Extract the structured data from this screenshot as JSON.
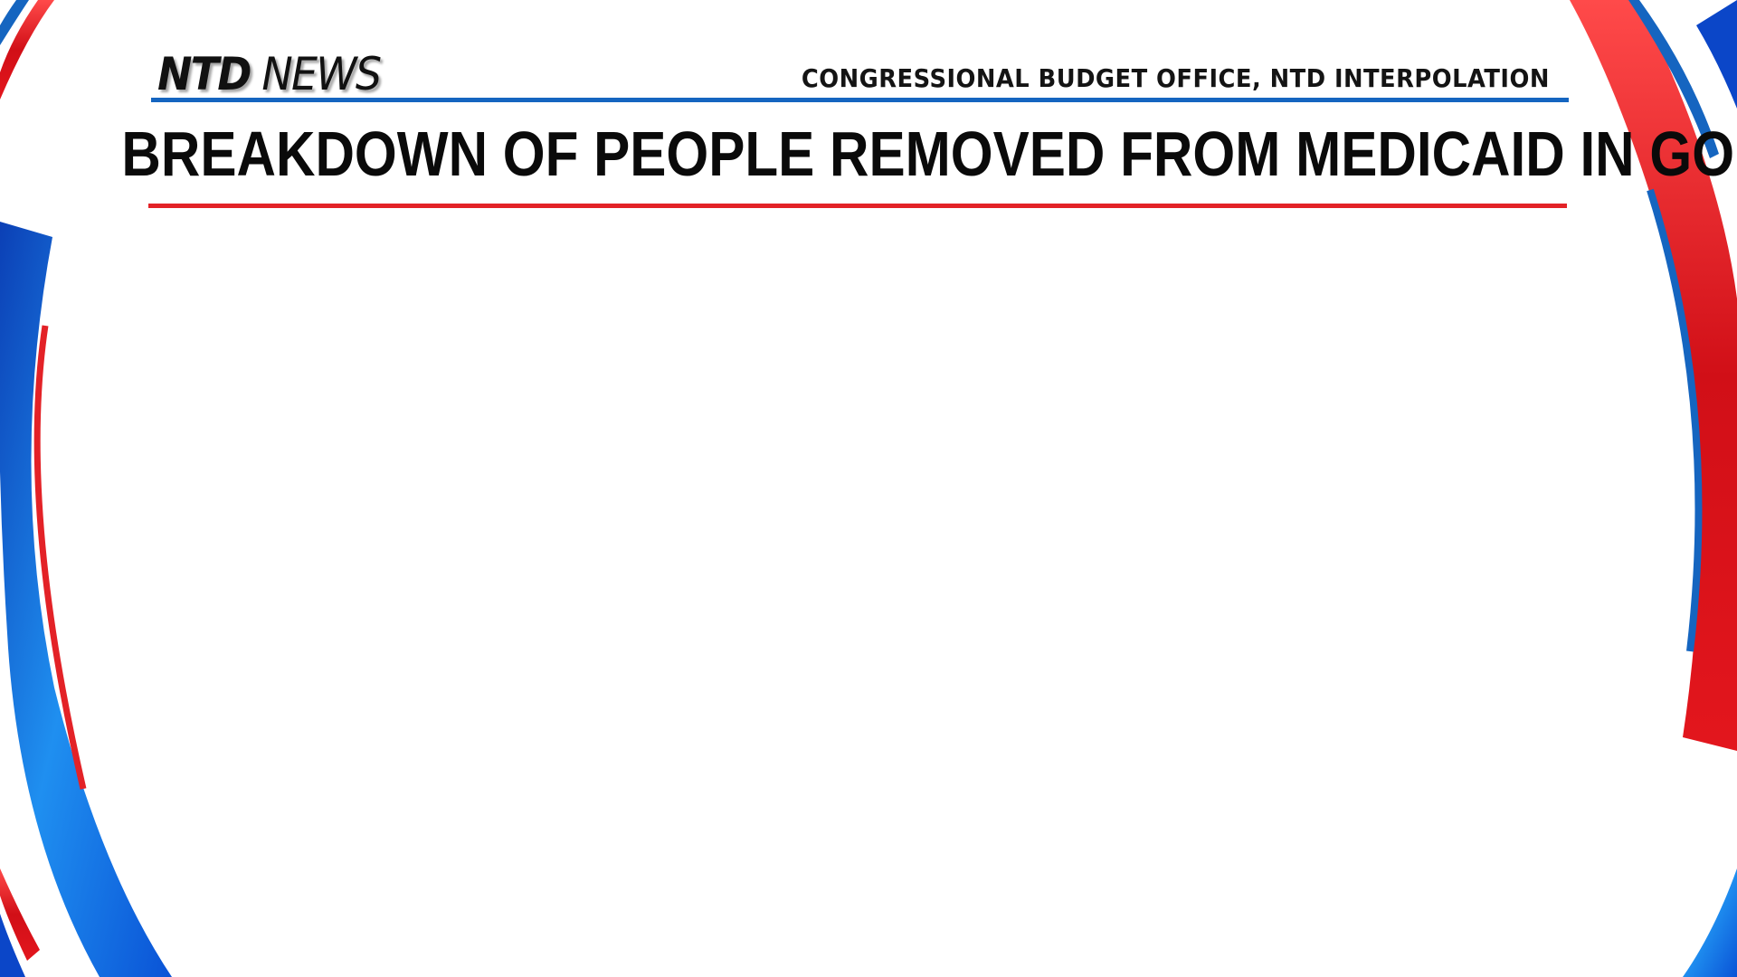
{
  "header": {
    "logo_ntd": "NTD",
    "logo_news": "NEWS",
    "source": "CONGRESSIONAL BUDGET OFFICE, NTD INTERPOLATION",
    "title": "BREAKDOWN OF PEOPLE REMOVED FROM MEDICAID IN GOP PLAN"
  },
  "colors": {
    "accent_blue": "#1565c0",
    "accent_red": "#e32227",
    "background": "#ffffff",
    "text": "#0a0a0a"
  }
}
